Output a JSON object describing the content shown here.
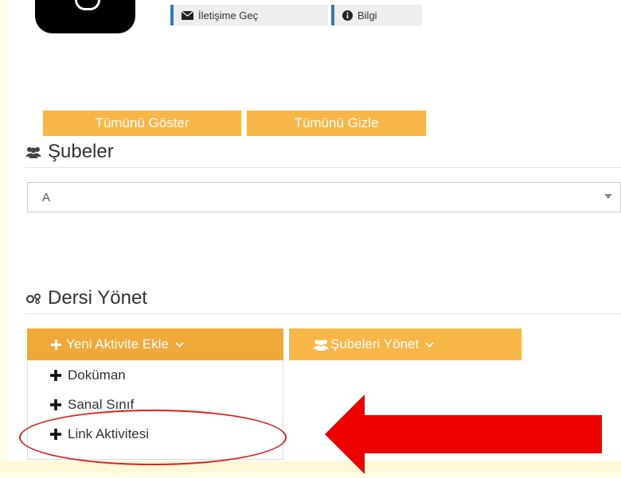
{
  "profile": {
    "contact_label": "İletişime Geç",
    "info_label": "Bilgi"
  },
  "toggles": {
    "show_all_label": "Tümünü Göster",
    "hide_all_label": "Tümünü Gizle"
  },
  "branches": {
    "title": "Şubeler",
    "selected_value": "A"
  },
  "course_manage": {
    "title": "Dersi Yönet",
    "add_activity_label": "Yeni Aktivite Ekle",
    "manage_branches_label": "Şubeleri Yönet",
    "dropdown_items": [
      {
        "label": "Doküman"
      },
      {
        "label": "Sanal Sınıf"
      },
      {
        "label": "Link Aktivitesi"
      }
    ]
  },
  "colors": {
    "accent_orange": "#f8b648",
    "button_orange": "#f0a838",
    "annotation_red": "#e02020",
    "tag_blue": "#337ab7"
  }
}
